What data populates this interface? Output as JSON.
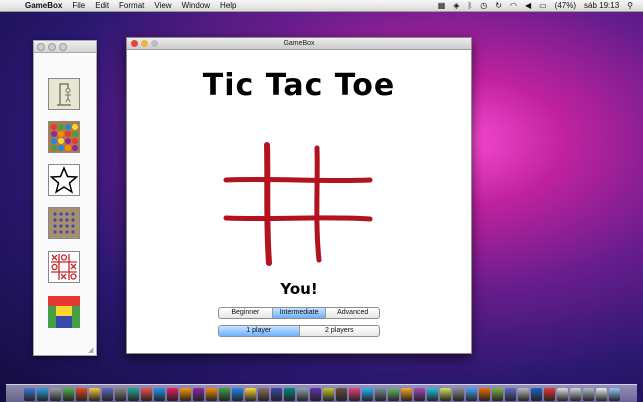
{
  "menubar": {
    "app_name": "GameBox",
    "items": [
      "File",
      "Edit",
      "Format",
      "View",
      "Window",
      "Help"
    ],
    "battery": "(47%)",
    "clock": "sáb 19:13"
  },
  "main_window": {
    "title": "GameBox",
    "game_title": "Tic Tac Toe",
    "status": "You!",
    "difficulty": {
      "options": [
        "Beginner",
        "Intermediate",
        "Advanced"
      ],
      "selected": "Intermediate"
    },
    "players": {
      "options": [
        "1 player",
        "2 players"
      ],
      "selected": "1 player"
    }
  },
  "palette": {
    "games": [
      "hangman-icon",
      "gems-icon",
      "star-icon",
      "pegs-icon",
      "tictactoe-icon",
      "colors-icon"
    ]
  },
  "colors": {
    "board_stroke": "#b2131c",
    "selected_segment": "#6fb2ff"
  },
  "dock_icon_colors": [
    "#3a7bd5",
    "#2b9fe6",
    "#9aa0a6",
    "#4fb548",
    "#e64a19",
    "#f7c948",
    "#5c6bc0",
    "#888888",
    "#26a69a",
    "#ef5350",
    "#2196f3",
    "#e91e63",
    "#ff9800",
    "#8e24aa",
    "#fb8c00",
    "#43a047",
    "#1e88e5",
    "#fdd835",
    "#8d6e63",
    "#3949ab",
    "#00897b",
    "#90a4ae",
    "#5e35b1",
    "#c0ca33",
    "#6d4c41",
    "#ec407a",
    "#29b6f6",
    "#78909c",
    "#66bb6a",
    "#ffa726",
    "#ab47bc",
    "#26c6da",
    "#d4e157",
    "#8d8d8d",
    "#42a5f5",
    "#ef6c00",
    "#7cb342",
    "#5c6bc0",
    "#bdbdbd",
    "#1565c0",
    "#e53935",
    "#e0e0e0",
    "#cfd8dc",
    "#b0bec5",
    "#eceff1",
    "#90caf9"
  ]
}
